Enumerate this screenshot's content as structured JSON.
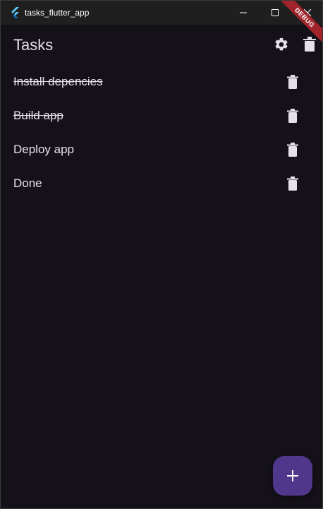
{
  "window": {
    "title": "tasks_flutter_app"
  },
  "appbar": {
    "title": "Tasks",
    "settings_icon": "gear-icon",
    "second_action_icon": "trash-icon"
  },
  "debug_banner": {
    "label": "DEBUG",
    "color": "#a0242a"
  },
  "tasks": [
    {
      "label": "Install depencies",
      "completed": true
    },
    {
      "label": "Build app",
      "completed": true
    },
    {
      "label": "Deploy app",
      "completed": false
    },
    {
      "label": "Done",
      "completed": false
    }
  ],
  "fab": {
    "icon": "plus-icon",
    "color": "#4f378b"
  },
  "colors": {
    "background": "#141218",
    "titlebar": "#1f1f1f",
    "text": "#e6e0e9"
  }
}
